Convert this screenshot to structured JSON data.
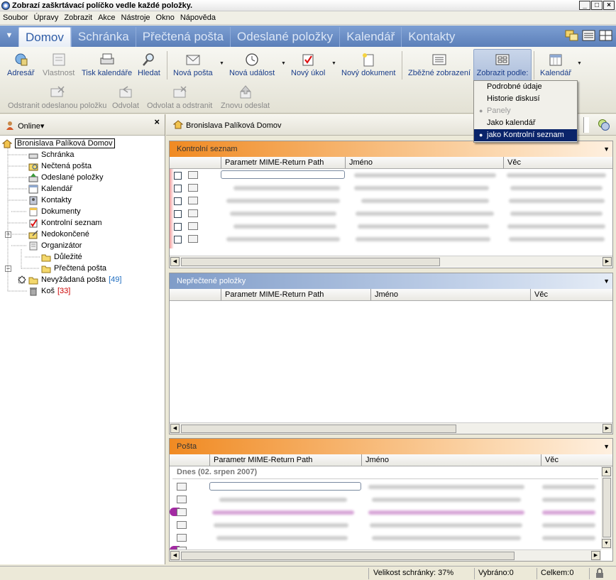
{
  "window": {
    "title": "Zobrazí zaškrtávací políčko vedle každé položky."
  },
  "menubar": [
    "Soubor",
    "Úpravy",
    "Zobrazit",
    "Akce",
    "Nástroje",
    "Okno",
    "Nápověda"
  ],
  "tabs": [
    "Domov",
    "Schránka",
    "Přečtená pošta",
    "Odeslané položky",
    "Kalendář",
    "Kontakty"
  ],
  "toolbar": {
    "row1": [
      "Adresář",
      "Vlastnost",
      "Tisk kalendáře",
      "Hledat",
      "Nová pošta",
      "Nová událost",
      "Nový úkol",
      "Nový dokument",
      "Zběžné zobrazení",
      "Zobrazit podle:",
      "Kalendář"
    ],
    "row2": [
      "Odstranit odeslanou položku",
      "Odvolat",
      "Odvolat a odstranit",
      "Znovu odeslat"
    ]
  },
  "dropdown": [
    "Podrobné údaje",
    "Historie diskusí",
    "Panely",
    "Jako kalendář",
    "jako Kontrolní seznam"
  ],
  "sidebar": {
    "status": "Online",
    "root": "Bronislava Palíková Domov",
    "items": [
      {
        "label": "Schránka",
        "count": ""
      },
      {
        "label": "Nečtená pošta",
        "count": ""
      },
      {
        "label": "Odeslané položky",
        "count": ""
      },
      {
        "label": "Kalendář",
        "count": ""
      },
      {
        "label": "Kontakty",
        "count": ""
      },
      {
        "label": "Dokumenty",
        "count": ""
      },
      {
        "label": "Kontrolní seznam",
        "count": ""
      },
      {
        "label": "Nedokončené",
        "count": ""
      },
      {
        "label": "Organizátor",
        "count": ""
      },
      {
        "label": "Důležité",
        "count": ""
      },
      {
        "label": "Přečtená pošta",
        "count": ""
      },
      {
        "label": "Nevyžádaná pošta",
        "count": "[49]"
      },
      {
        "label": "Koš",
        "count": "[33]"
      }
    ]
  },
  "main": {
    "breadcrumb": "Bronislava Palíková Domov",
    "panels": [
      {
        "title": "Kontrolní seznam",
        "columns": [
          "Parametr MIME-Return Path",
          "Jméno",
          "Věc"
        ]
      },
      {
        "title": "Nepřečtené položky",
        "columns": [
          "Parametr MIME-Return Path",
          "Jméno",
          "Věc"
        ]
      },
      {
        "title": "Pošta",
        "columns": [
          "Parametr MIME-Return Path",
          "Jméno",
          "Věc"
        ],
        "group": "Dnes (02. srpen 2007)"
      }
    ]
  },
  "statusbar": {
    "size": "Velikost schránky: 37%",
    "selected": "Vybráno:0",
    "total": "Celkem:0"
  }
}
